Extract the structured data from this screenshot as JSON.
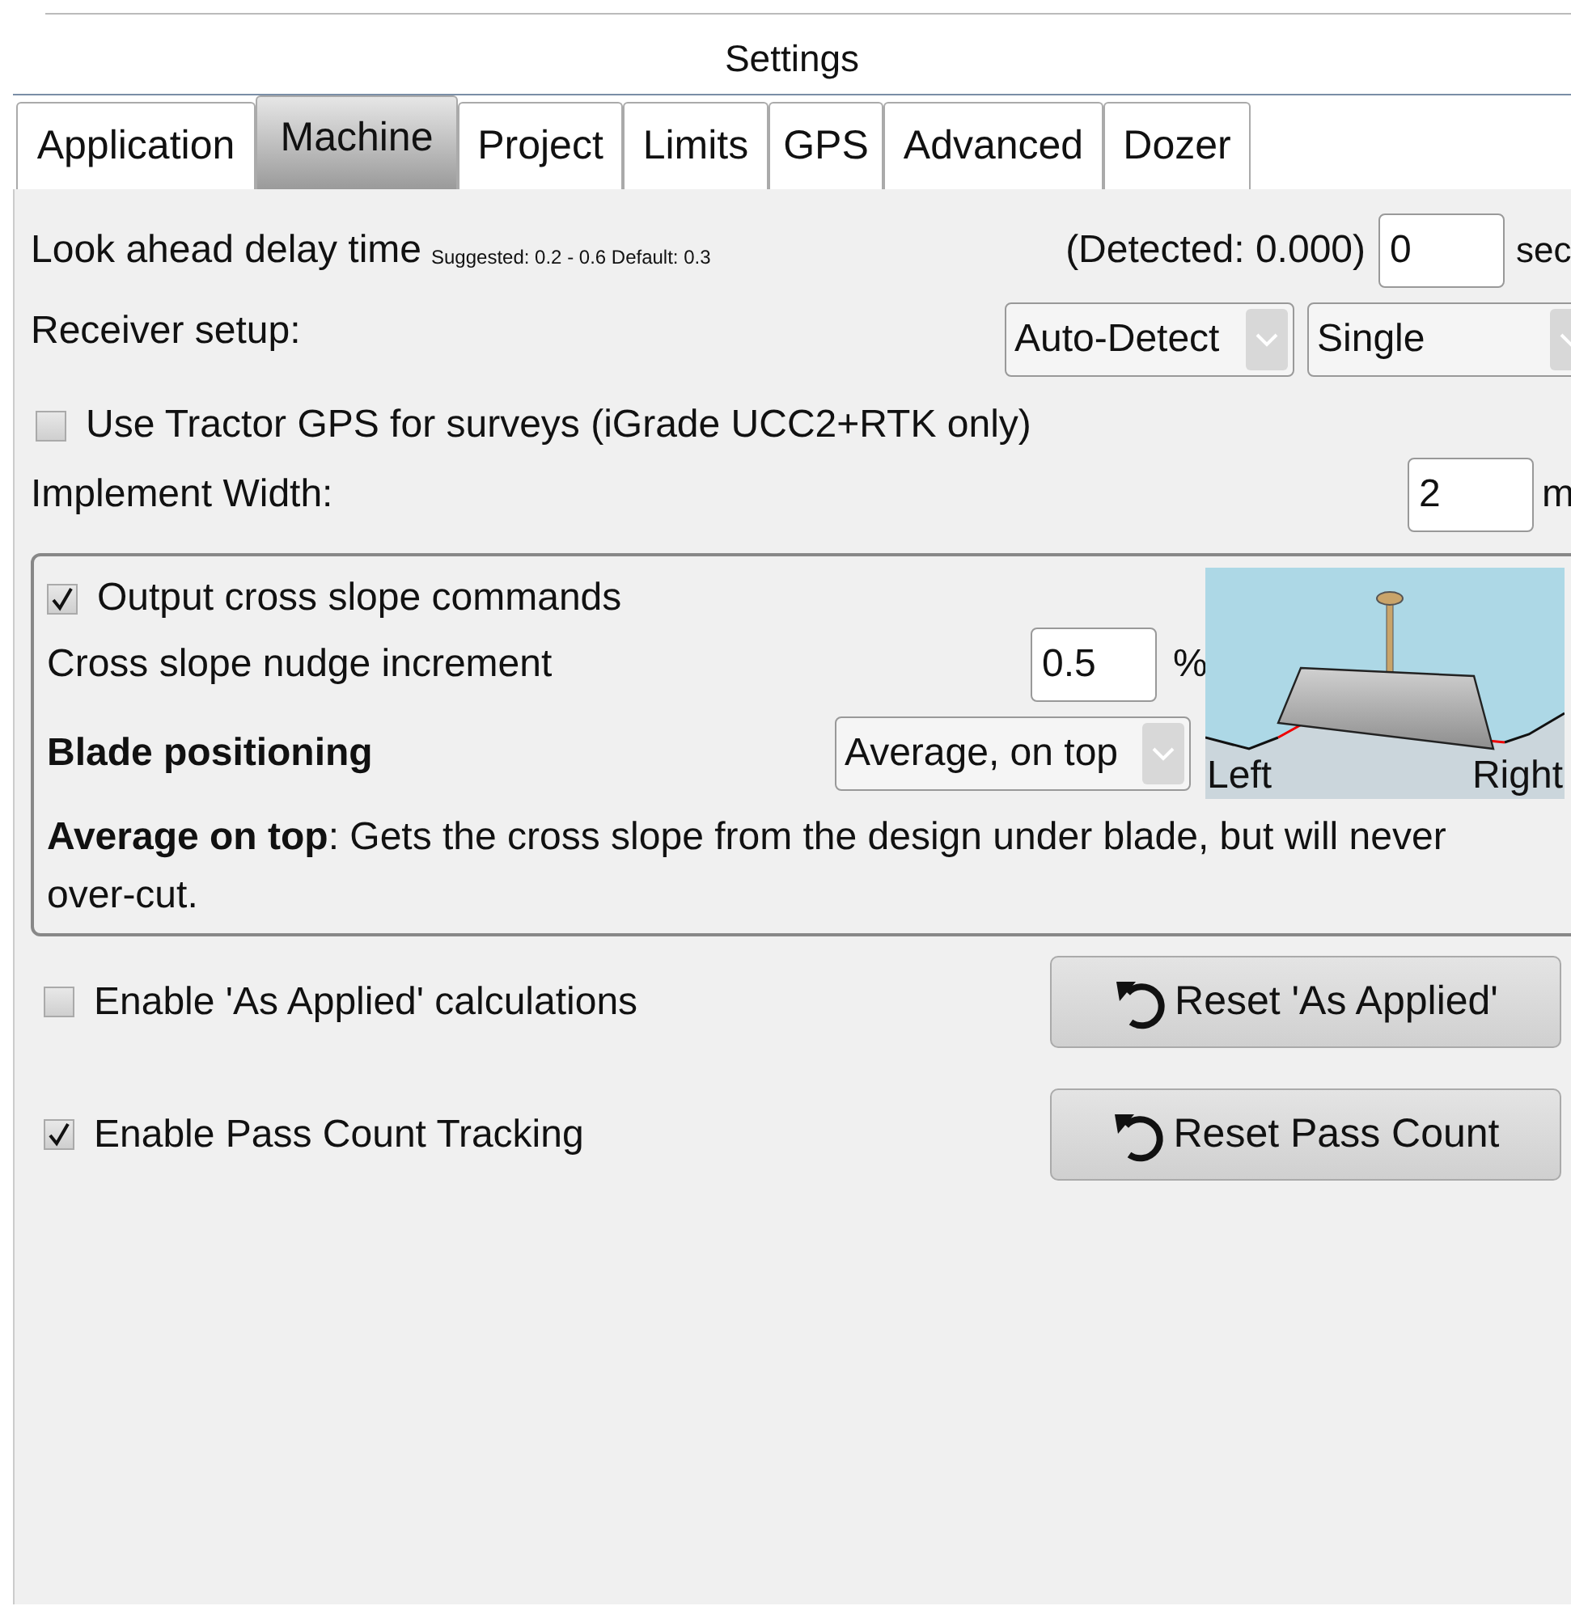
{
  "window": {
    "title": "Settings"
  },
  "tabs": [
    {
      "label": "Application",
      "selected": false
    },
    {
      "label": "Machine",
      "selected": true
    },
    {
      "label": "Project",
      "selected": false
    },
    {
      "label": "Limits",
      "selected": false
    },
    {
      "label": "GPS",
      "selected": false
    },
    {
      "label": "Advanced",
      "selected": false
    },
    {
      "label": "Dozer",
      "selected": false
    }
  ],
  "look_ahead": {
    "label": "Look ahead delay time",
    "hint": "Suggested: 0.2 - 0.6 Default: 0.3",
    "detected": "(Detected: 0.000)",
    "value": "0",
    "unit": "sec"
  },
  "receiver_setup": {
    "label": "Receiver setup:",
    "source": "Auto-Detect",
    "mode": "Single"
  },
  "use_tractor_gps": {
    "label": "Use Tractor GPS for surveys (iGrade UCC2+RTK only)",
    "checked": false
  },
  "implement_width": {
    "label": "Implement Width:",
    "value": "2",
    "unit": "m"
  },
  "cross_slope": {
    "output": {
      "label": "Output cross slope commands",
      "checked": true
    },
    "nudge": {
      "label": "Cross slope nudge increment",
      "value": "0.5",
      "unit": "%"
    },
    "blade_positioning": {
      "label": "Blade positioning",
      "value": "Average, on top"
    },
    "description": "**Average on top**: Gets the cross slope from the design under blade, but will never over-cut.",
    "diagram": {
      "left_label": "Left",
      "right_label": "Right"
    }
  },
  "options": [
    {
      "label": "Enable 'As Applied' calculations",
      "checked": false,
      "button": "Reset 'As Applied'"
    },
    {
      "label": "Enable Pass Count Tracking",
      "checked": true,
      "button": "Reset Pass Count"
    }
  ]
}
